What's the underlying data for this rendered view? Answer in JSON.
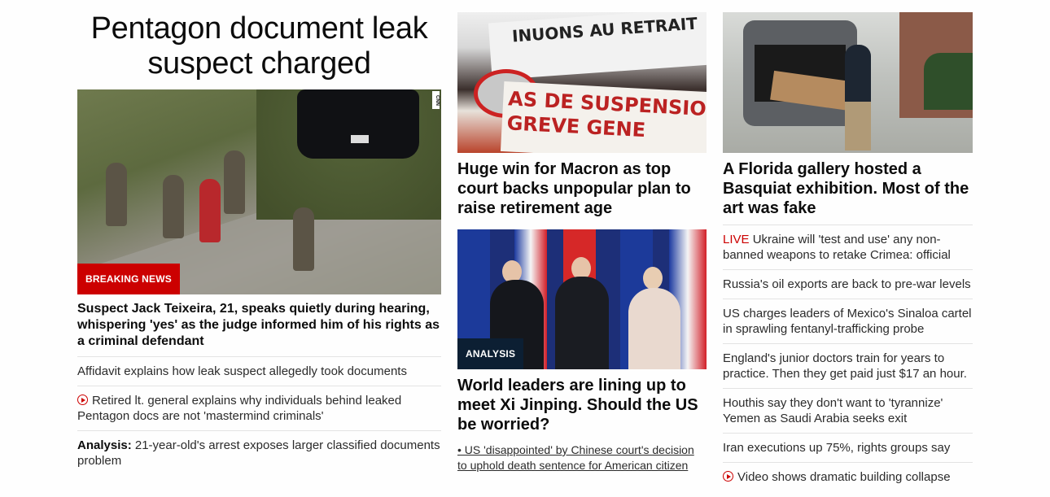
{
  "lead": {
    "headline": "Pentagon document leak suspect charged",
    "image_badge": "BREAKING NEWS",
    "subheadline": "Suspect Jack Teixeira, 21, speaks quietly during hearing, whispering 'yes' as the judge informed him of his rights as a criminal defendant",
    "links": [
      {
        "text": "Affidavit explains how leak suspect allegedly took documents"
      },
      {
        "text": "Retired lt. general explains why individuals behind leaked Pentagon docs are not 'mastermind criminals'",
        "icon": "play-icon"
      },
      {
        "prefix": "Analysis:",
        "text": "21-year-old's arrest exposes larger classified documents problem"
      }
    ],
    "image_bug": "CNN"
  },
  "middle": {
    "story1": {
      "headline": "Huge win for Macron as top court backs unpopular plan to raise retirement age",
      "banner_top": "INUONS AU RETRAIT",
      "banner_bottom": "AS DE SUSPENSIO GREVE GENE"
    },
    "story2": {
      "image_badge": "ANALYSIS",
      "headline": "World leaders are lining up to meet Xi Jinping. Should the US be worried?",
      "note": "• US 'disappointed' by Chinese court's decision to uphold death sentence for American citizen"
    }
  },
  "right": {
    "story1": {
      "headline": "A Florida gallery hosted a Basquiat exhibition. Most of the art was fake"
    },
    "links": [
      {
        "live_label": "LIVE",
        "text": "Ukraine will 'test and use' any non-banned weapons to retake Crimea: official"
      },
      {
        "text": "Russia's oil exports are back to pre-war levels"
      },
      {
        "text": "US charges leaders of Mexico's Sinaloa cartel in sprawling fentanyl-trafficking probe"
      },
      {
        "text": "England's junior doctors train for years to practice. Then they get paid just $17 an hour."
      },
      {
        "text": "Houthis say they don't want to 'tyrannize' Yemen as Saudi Arabia seeks exit"
      },
      {
        "text": "Iran executions up 75%, rights groups say"
      },
      {
        "text": "Video shows dramatic building collapse",
        "icon": "play-icon"
      }
    ]
  },
  "colors": {
    "accent_red": "#cc0000",
    "badge_dark": "#0c1f33",
    "divider": "#e3e3e3"
  }
}
